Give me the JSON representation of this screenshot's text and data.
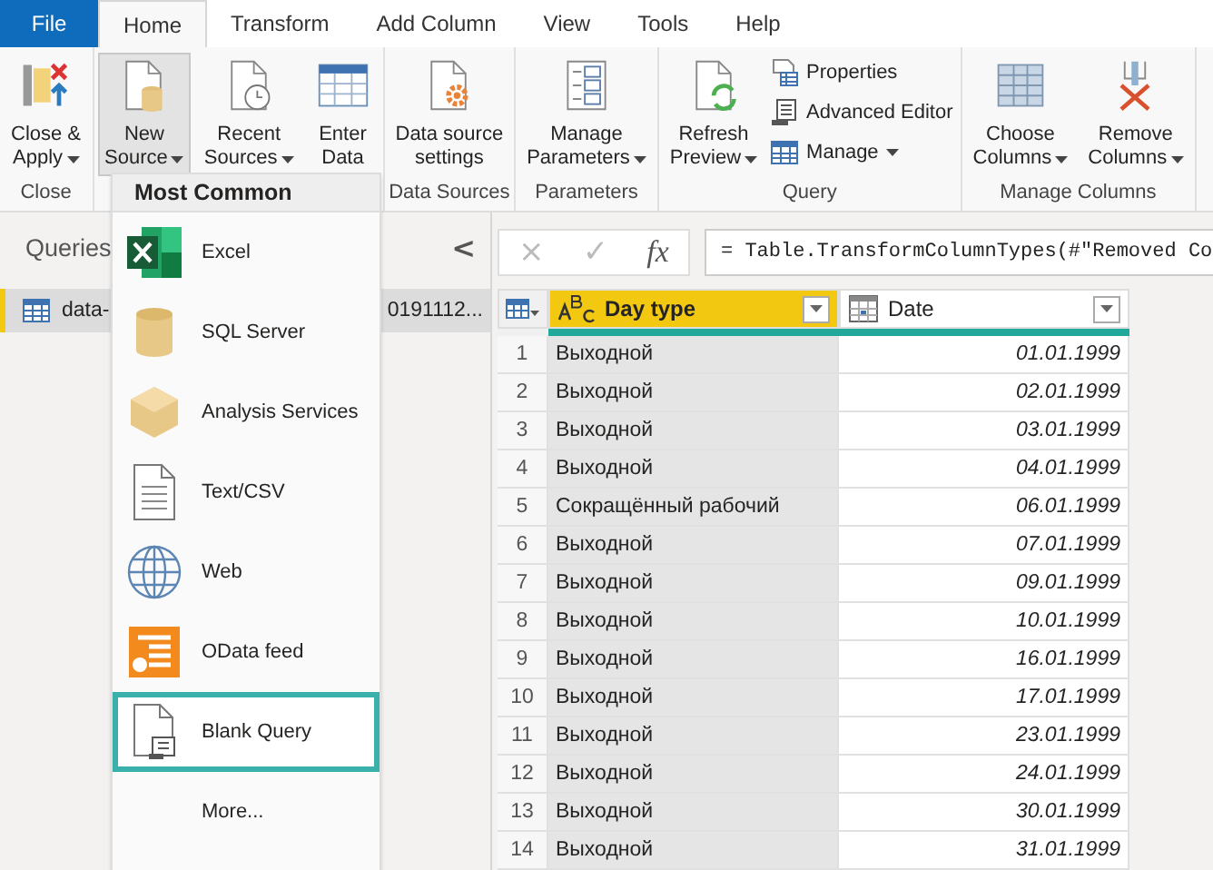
{
  "tabs": [
    {
      "label": "File",
      "kind": "file",
      "selected": false
    },
    {
      "label": "Home",
      "kind": "tab",
      "selected": true
    },
    {
      "label": "Transform",
      "kind": "tab",
      "selected": false
    },
    {
      "label": "Add Column",
      "kind": "tab",
      "selected": false
    },
    {
      "label": "View",
      "kind": "tab",
      "selected": false
    },
    {
      "label": "Tools",
      "kind": "tab",
      "selected": false
    },
    {
      "label": "Help",
      "kind": "tab",
      "selected": false
    }
  ],
  "ribbon": {
    "groups": [
      {
        "label": "Close",
        "large_buttons": [
          {
            "lines": [
              "Close &",
              "Apply"
            ],
            "menu": true,
            "expanded": false
          }
        ]
      },
      {
        "large_buttons": [
          {
            "lines": [
              "New",
              "Source"
            ],
            "menu": true,
            "expanded": true
          },
          {
            "lines": [
              "Recent",
              "Sources"
            ],
            "menu": true,
            "expanded": false
          },
          {
            "lines": [
              "Enter",
              "Data"
            ],
            "menu": false,
            "expanded": false
          }
        ]
      },
      {
        "label": "Data Sources",
        "large_buttons": [
          {
            "lines": [
              "Data source",
              "settings"
            ],
            "menu": false,
            "expanded": false
          }
        ]
      },
      {
        "label": "Parameters",
        "large_buttons": [
          {
            "lines": [
              "Manage",
              "Parameters"
            ],
            "menu": true,
            "expanded": false
          }
        ]
      },
      {
        "label": "Query",
        "large_buttons": [
          {
            "lines": [
              "Refresh",
              "Preview"
            ],
            "menu": true,
            "expanded": false
          }
        ],
        "small_buttons": [
          {
            "label": "Properties",
            "menu": false
          },
          {
            "label": "Advanced Editor",
            "menu": false
          },
          {
            "label": "Manage",
            "menu": true
          }
        ]
      },
      {
        "label": "Manage Columns",
        "large_buttons": [
          {
            "lines": [
              "Choose",
              "Columns"
            ],
            "menu": true,
            "expanded": false
          },
          {
            "lines": [
              "Remove",
              "Columns"
            ],
            "menu": true,
            "expanded": false
          }
        ]
      }
    ]
  },
  "new_source_menu": {
    "header": "Most Common",
    "items": [
      {
        "label": "Excel",
        "selected": false
      },
      {
        "label": "SQL Server",
        "selected": false
      },
      {
        "label": "Analysis Services",
        "selected": false
      },
      {
        "label": "Text/CSV",
        "selected": false
      },
      {
        "label": "Web",
        "selected": false
      },
      {
        "label": "OData feed",
        "selected": false
      },
      {
        "label": "Blank Query",
        "selected": true
      },
      {
        "label": "More...",
        "selected": false
      }
    ]
  },
  "queries_pane": {
    "title": "Queries",
    "collapse": "<",
    "queries": [
      {
        "name_start": "data-",
        "name_end": "0191112...",
        "selected": true
      }
    ]
  },
  "formula_bar": {
    "cancel": "×",
    "confirm": "✓",
    "fx": "fx",
    "formula": "= Table.TransformColumnTypes(#\"Removed Co"
  },
  "table": {
    "columns": [
      {
        "name": "Day type",
        "kind": "text",
        "selected": true
      },
      {
        "name": "Date",
        "kind": "date",
        "selected": false
      }
    ],
    "rows": [
      {
        "n": "1",
        "day_type": "Выходной",
        "date": "01.01.1999"
      },
      {
        "n": "2",
        "day_type": "Выходной",
        "date": "02.01.1999"
      },
      {
        "n": "3",
        "day_type": "Выходной",
        "date": "03.01.1999"
      },
      {
        "n": "4",
        "day_type": "Выходной",
        "date": "04.01.1999"
      },
      {
        "n": "5",
        "day_type": "Сокращённый рабочий",
        "date": "06.01.1999"
      },
      {
        "n": "6",
        "day_type": "Выходной",
        "date": "07.01.1999"
      },
      {
        "n": "7",
        "day_type": "Выходной",
        "date": "09.01.1999"
      },
      {
        "n": "8",
        "day_type": "Выходной",
        "date": "10.01.1999"
      },
      {
        "n": "9",
        "day_type": "Выходной",
        "date": "16.01.1999"
      },
      {
        "n": "10",
        "day_type": "Выходной",
        "date": "17.01.1999"
      },
      {
        "n": "11",
        "day_type": "Выходной",
        "date": "23.01.1999"
      },
      {
        "n": "12",
        "day_type": "Выходной",
        "date": "24.01.1999"
      },
      {
        "n": "13",
        "day_type": "Выходной",
        "date": "30.01.1999"
      },
      {
        "n": "14",
        "day_type": "Выходной",
        "date": "31.01.1999"
      }
    ]
  }
}
